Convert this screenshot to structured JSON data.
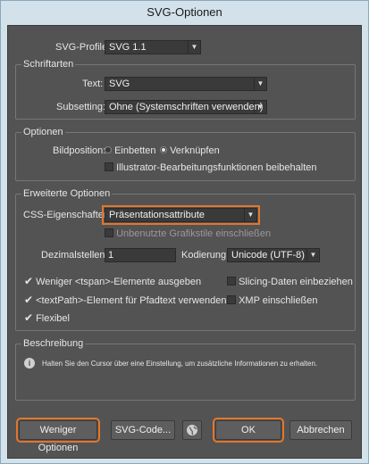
{
  "window": {
    "title": "SVG-Optionen"
  },
  "svg_profile": {
    "label": "SVG-Profile:",
    "value": "SVG 1.1"
  },
  "schriftarten": {
    "title": "Schriftarten",
    "text_label": "Text:",
    "text_value": "SVG",
    "subsetting_label": "Subsetting:",
    "subsetting_value": "Ohne (Systemschriften verwenden)"
  },
  "optionen": {
    "title": "Optionen",
    "bildposition_label": "Bildposition:",
    "radio_einbetten": "Einbetten",
    "radio_verknuepfen": "Verknüpfen",
    "checkbox_illustrator": "Illustrator-Bearbeitungsfunktionen beibehalten"
  },
  "erweitert": {
    "title": "Erweiterte Optionen",
    "css_label": "CSS-Eigenschaften:",
    "css_value": "Präsentationsattribute",
    "unused_styles": "Unbenutzte Grafikstile einschließen",
    "dezimal_label": "Dezimalstellen:",
    "dezimal_value": "1",
    "kodierung_label": "Kodierung:",
    "kodierung_value": "Unicode (UTF-8)",
    "cb_tspan": "Weniger <tspan>-Elemente ausgeben",
    "cb_textpath": "<textPath>-Element für Pfadtext verwenden",
    "cb_flexibel": "Flexibel",
    "cb_slicing": "Slicing-Daten einbeziehen",
    "cb_xmp": "XMP einschließen"
  },
  "beschreibung": {
    "title": "Beschreibung",
    "text": "Halten Sie den Cursor über eine Einstellung, um zusätzliche Informationen zu erhalten."
  },
  "buttons": {
    "fewer_options": "Weniger Optionen",
    "svg_code": "SVG-Code...",
    "ok": "OK",
    "cancel": "Abbrechen"
  }
}
